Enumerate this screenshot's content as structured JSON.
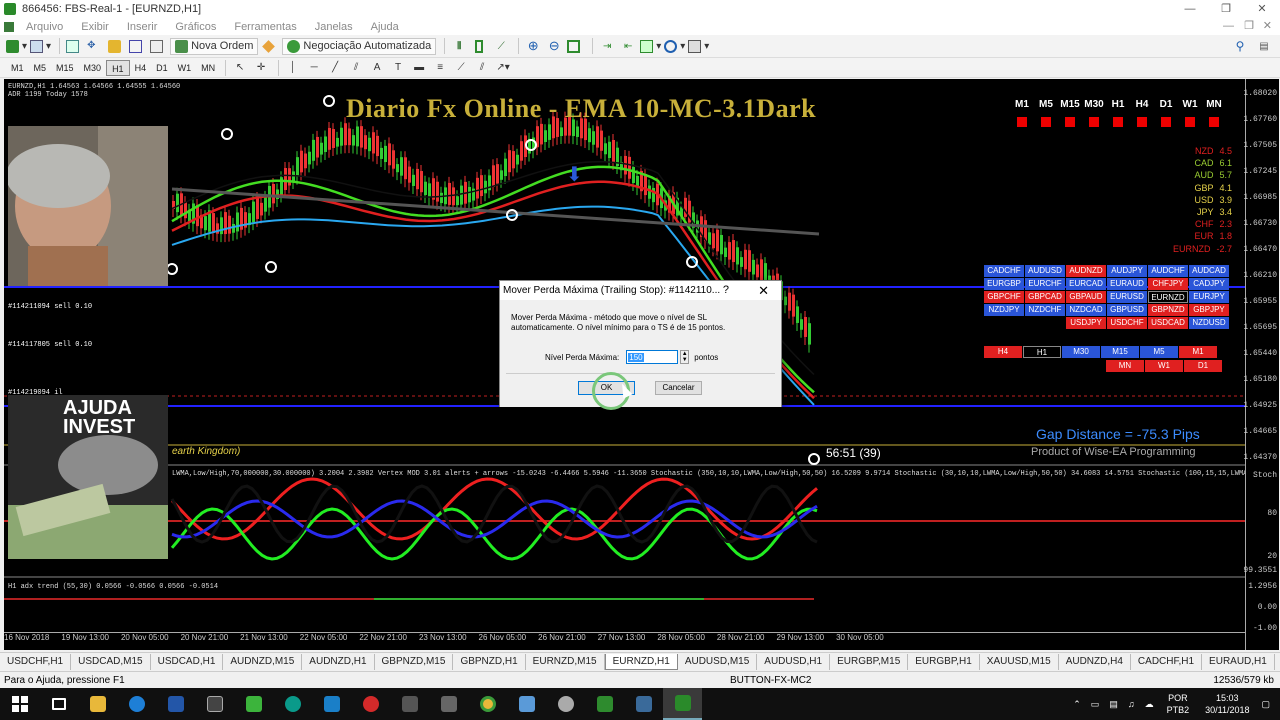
{
  "window": {
    "title": "866456: FBS-Real-1 - [EURNZD,H1]",
    "minimize": "—",
    "maximize": "❐",
    "close": "✕"
  },
  "menu": [
    "Arquivo",
    "Exibir",
    "Inserir",
    "Gráficos",
    "Ferramentas",
    "Janelas",
    "Ajuda"
  ],
  "toolbar": {
    "new_order": "Nova Ordem",
    "auto_trading": "Negociação Automatizada"
  },
  "timeframes": [
    "M1",
    "M5",
    "M15",
    "M30",
    "H1",
    "H4",
    "D1",
    "W1",
    "MN"
  ],
  "selected_timeframe": "H1",
  "chart": {
    "symbol_line1": "EURNZD,H1  1.64563 1.64566 1.64555 1.64560",
    "symbol_line2": "ADR 1199  Today 1578",
    "title": "Diario Fx Online - EMA 10-MC-3.1Dark",
    "tf_labels": [
      "M1",
      "M5",
      "M15",
      "M30",
      "H1",
      "H4",
      "D1",
      "W1",
      "MN"
    ],
    "strength": [
      {
        "cur": "NZD",
        "val": "4.5",
        "color": "#e02020"
      },
      {
        "cur": "CAD",
        "val": "6.1",
        "color": "#9acd32"
      },
      {
        "cur": "AUD",
        "val": "5.7",
        "color": "#9acd32"
      },
      {
        "cur": "GBP",
        "val": "4.1",
        "color": "#e6d24a"
      },
      {
        "cur": "USD",
        "val": "3.9",
        "color": "#e6d24a"
      },
      {
        "cur": "JPY",
        "val": "3.4",
        "color": "#e6d24a"
      },
      {
        "cur": "CHF",
        "val": "2.3",
        "color": "#e02020"
      },
      {
        "cur": "EUR",
        "val": "1.8",
        "color": "#e02020"
      },
      {
        "cur": "EURNZD",
        "val": "-2.7",
        "color": "#e02020"
      }
    ],
    "pairs": [
      [
        "CADCHF",
        "b"
      ],
      [
        "AUDUSD",
        "b"
      ],
      [
        "AUDNZD",
        "r"
      ],
      [
        "AUDJPY",
        "b"
      ],
      [
        "AUDCHF",
        "b"
      ],
      [
        "AUDCAD",
        "b"
      ],
      [
        "EURGBP",
        "b"
      ],
      [
        "EURCHF",
        "b"
      ],
      [
        "EURCAD",
        "b"
      ],
      [
        "EURAUD",
        "b"
      ],
      [
        "CHFJPY",
        "r"
      ],
      [
        "CADJPY",
        "b"
      ],
      [
        "GBPCHF",
        "r"
      ],
      [
        "GBPCAD",
        "r"
      ],
      [
        "GBPAUD",
        "r"
      ],
      [
        "EURUSD",
        "b"
      ],
      [
        "EURNZD",
        "k"
      ],
      [
        "EURJPY",
        "b"
      ],
      [
        "NZDJPY",
        "b"
      ],
      [
        "NZDCHF",
        "b"
      ],
      [
        "NZDCAD",
        "b"
      ],
      [
        "GBPUSD",
        "b"
      ],
      [
        "GBPNZD",
        "r"
      ],
      [
        "GBPJPY",
        "r"
      ],
      [
        "",
        ""
      ],
      [
        "",
        ""
      ],
      [
        "USDJPY",
        "r"
      ],
      [
        "USDCHF",
        "r"
      ],
      [
        "USDCAD",
        "r"
      ],
      [
        "NZDUSD",
        "b"
      ]
    ],
    "tf_buttons": [
      [
        "H4",
        "r"
      ],
      [
        "H1",
        "k"
      ],
      [
        "M30",
        "b"
      ],
      [
        "M15",
        "b"
      ],
      [
        "M5",
        "b"
      ],
      [
        "M1",
        "r"
      ]
    ],
    "tf_buttons2": [
      "MN",
      "W1",
      "D1"
    ],
    "gap_text": "Gap Distance = -75.3 Pips",
    "wise_text": "Product of Wise-EA Programming",
    "timer": "56:51 (39)",
    "kingdom": "earth Kingdom)",
    "indicator_line": "LWMA,Low/High,70,000000,30.000000) 3.2004 2.3982   Vertex MOD 3.01 alerts + arrows -15.0243 -6.4466 5.5946 -11.3650   Stochastic (350,10,10,LWMA,Low/High,50,50) 16.5209 9.9714   Stochastic (30,10,10,LWMA,Low/High,50,50) 34.6083 14.5751   Stochastic (100,15,15,LWMA,Low/High,50,50) 26.0538 18.0268",
    "adx": "H1 adx trend (55,30) 0.0566 -0.0566 0.0566 -0.0514",
    "order_labels": [
      "#114211094 sell 0.10",
      "#114117805 sell 0.10",
      "#114219094 il"
    ],
    "logo_text": "AJUDA INVEST",
    "prices": [
      "1.68020",
      "1.67760",
      "1.67505",
      "1.67245",
      "1.66985",
      "1.66730",
      "1.66470",
      "1.66210",
      "1.65955",
      "1.65695",
      "1.65440",
      "1.65180",
      "1.64925",
      "1.64665",
      "1.64370"
    ],
    "osc_axis": [
      "Stoch",
      "80",
      "20",
      "99.3551",
      "1.2956",
      "0.00",
      "-1.00"
    ],
    "time_labels": [
      "16 Nov 2018",
      "19 Nov 13:00",
      "20 Nov 05:00",
      "20 Nov 21:00",
      "21 Nov 13:00",
      "22 Nov 05:00",
      "22 Nov 21:00",
      "23 Nov 13:00",
      "26 Nov 05:00",
      "26 Nov 21:00",
      "27 Nov 13:00",
      "28 Nov 05:00",
      "28 Nov 21:00",
      "29 Nov 13:00",
      "30 Nov 05:00"
    ]
  },
  "dialog": {
    "title": "Mover Perda Máxima (Trailing Stop): #1142110...",
    "help": "?",
    "close": "✕",
    "desc": "Mover Perda Máxima - método que move o nível de SL automaticamente. O nível mínimo para o TS é de 15 pontos.",
    "field_label": "Nível Perda Máxima:",
    "field_value": "150",
    "unit": "pontos",
    "ok": "OK",
    "cancel": "Cancelar"
  },
  "tabs": [
    "USDCHF,H1",
    "USDCAD,M15",
    "USDCAD,H1",
    "AUDNZD,M15",
    "AUDNZD,H1",
    "GBPNZD,M15",
    "GBPNZD,H1",
    "EURNZD,M15",
    "EURNZD,H1",
    "AUDUSD,M15",
    "AUDUSD,H1",
    "EURGBP,M15",
    "EURGBP,H1",
    "XAUUSD,M15",
    "AUDNZD,H4",
    "CADCHF,H1",
    "EURAUD,H1"
  ],
  "active_tab": "EURNZD,H1",
  "status": {
    "help": "Para o Ajuda, pressione F1",
    "profile": "BUTTON-FX-MC2",
    "traffic": "12536/579 kb"
  },
  "tray": {
    "lang1": "POR",
    "lang2": "PTB2",
    "time": "15:03",
    "date": "30/11/2018"
  },
  "colors": {
    "chart_bg": "#000000",
    "title_gold": "#c8b03a",
    "ema_green": "#44dd22",
    "ema_red": "#e02020",
    "ema_blue": "#2aa8f0",
    "level_blue": "#2222ff"
  }
}
